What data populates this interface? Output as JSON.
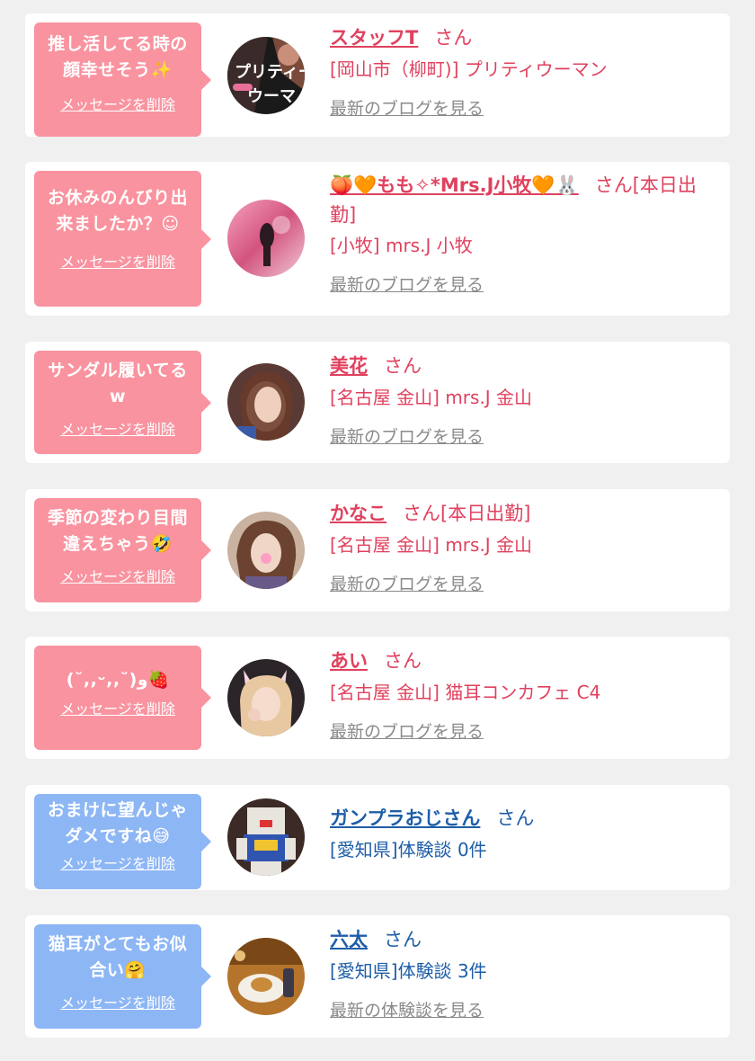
{
  "items": [
    {
      "message": "推し活してる時の\n顔幸せそう✨",
      "delete_label": "メッセージを削除",
      "name": "スタッフT",
      "suffix": "さん",
      "shop": "[岡山市（柳町)] プリティウーマン",
      "blog_link": "最新のブログを見る"
    },
    {
      "message": "お休みのんびり出\n来ましたか？☺",
      "delete_label": "メッセージを削除",
      "name": "🍑🧡もも✧*Mrs.J小牧🧡🐰",
      "suffix": "さん[本日出勤]",
      "shop": "[小牧] mrs.J 小牧",
      "blog_link": "最新のブログを見る"
    },
    {
      "message": "サンダル履いてる\nw",
      "delete_label": "メッセージを削除",
      "name": "美花",
      "suffix": "さん",
      "shop": "[名古屋 金山] mrs.J 金山",
      "blog_link": "最新のブログを見る"
    },
    {
      "message": "季節の変わり目間\n違えちゃう🤣",
      "delete_label": "メッセージを削除",
      "name": "かなこ",
      "suffix": "さん[本日出勤]",
      "shop": "[名古屋 金山] mrs.J 金山",
      "blog_link": "最新のブログを見る"
    },
    {
      "message": "(˘,,ᵕ,,˘)و🍓",
      "delete_label": "メッセージを削除",
      "name": "あい",
      "suffix": "さん",
      "shop": "[名古屋 金山] 猫耳コンカフェ C4",
      "blog_link": "最新のブログを見る"
    },
    {
      "message": "おまけに望んじゃ\nダメですね😅",
      "delete_label": "メッセージを削除",
      "name": "ガンプラおじさん",
      "suffix": "さん",
      "shop": "[愛知県]体験談 0件",
      "blog_link": ""
    },
    {
      "message": "猫耳がとてもお似\n合い🤗",
      "delete_label": "メッセージを削除",
      "name": "六太",
      "suffix": "さん",
      "shop": "[愛知県]体験談 3件",
      "blog_link": "最新の体験談を見る"
    }
  ],
  "colors": {
    "page_bg": "#f0f0f0",
    "card_bg": "#ffffff",
    "pink_bubble": "#f9939f",
    "blue_bubble": "#8db6f5",
    "pink_text": "#e0415e",
    "blue_text": "#1e5ea8",
    "link_gray": "#8a8a8a"
  }
}
